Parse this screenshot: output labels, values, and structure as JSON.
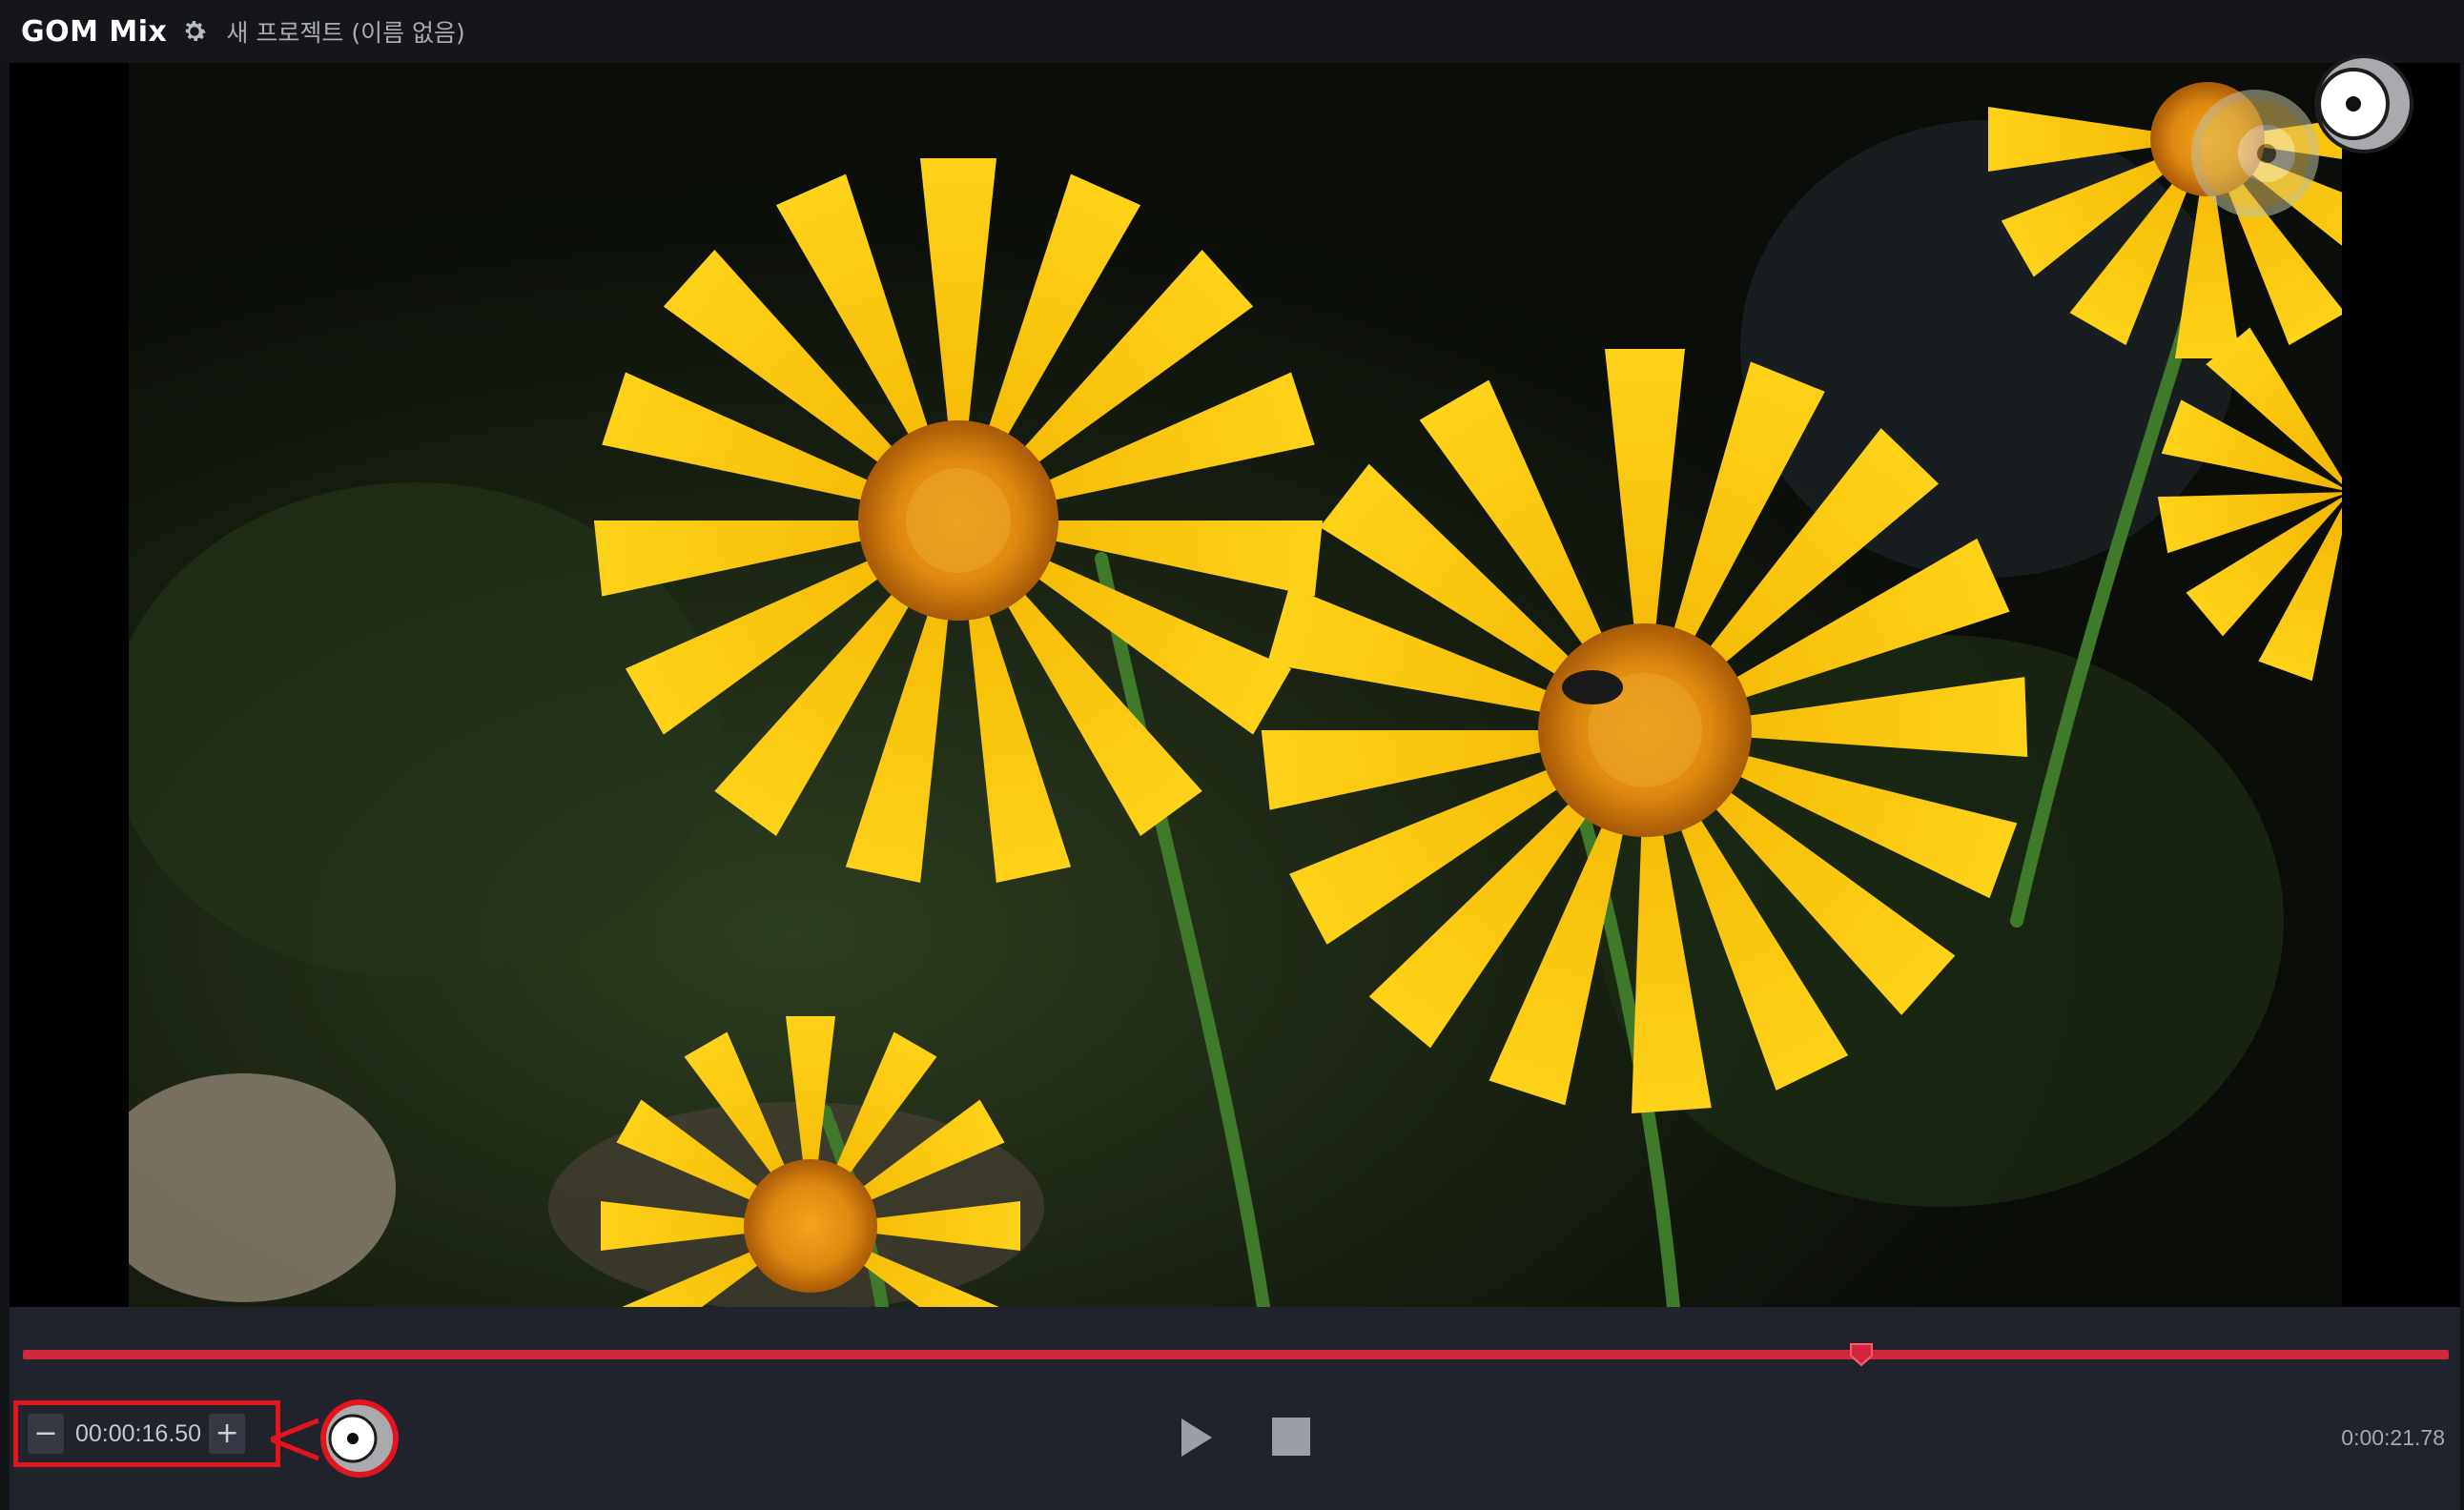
{
  "app": {
    "logo": "GOM Mix",
    "project_name": "새 프로젝트 (이름 없음)"
  },
  "player": {
    "current_time": "00:00:16.50",
    "duration": "0:00:21.78",
    "progress": 0.758,
    "decrement_label": "−",
    "increment_label": "+"
  },
  "colors": {
    "accent": "#d0273e",
    "highlight": "#e3141e",
    "panel": "#21232c",
    "titlebar": "#151619"
  },
  "icons": {
    "settings": "gear-icon",
    "play": "play-icon",
    "stop": "stop-icon"
  }
}
